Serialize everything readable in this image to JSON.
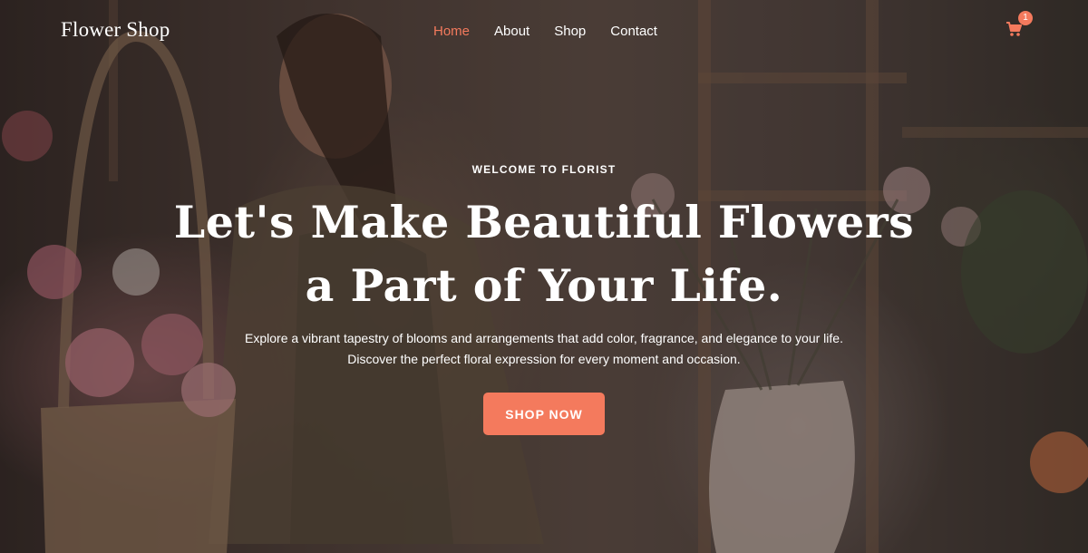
{
  "brand": {
    "name": "Flower Shop"
  },
  "nav": {
    "items": [
      {
        "label": "Home",
        "active": true
      },
      {
        "label": "About",
        "active": false
      },
      {
        "label": "Shop",
        "active": false
      },
      {
        "label": "Contact",
        "active": false
      }
    ]
  },
  "cart": {
    "icon": "shopping-cart-icon",
    "count": "1"
  },
  "hero": {
    "eyebrow": "WELCOME TO FLORIST",
    "headline_line1": "Let's Make Beautiful Flowers",
    "headline_line2": "a Part of Your Life.",
    "sub_line1": "Explore a vibrant tapestry of blooms and arrangements that add color, fragrance, and elegance to your life.",
    "sub_line2": "Discover the perfect floral expression for every moment and occasion.",
    "cta_label": "SHOP NOW"
  },
  "colors": {
    "accent": "#f47a5d",
    "text": "#ffffff",
    "overlay": "#140e0c"
  }
}
